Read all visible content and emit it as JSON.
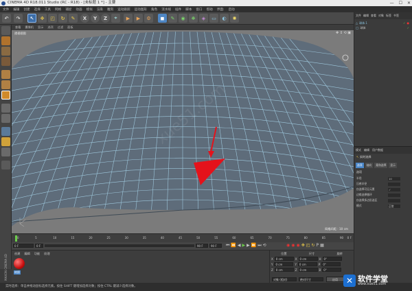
{
  "window": {
    "title": "CINEMA 4D R18.011 Studio (RC - R18) - [未标题 1 *] - 主要",
    "controls": [
      "—",
      "☐",
      "✕"
    ]
  },
  "menu": [
    "文件",
    "编辑",
    "创建",
    "选择",
    "工具",
    "网格",
    "捕捉",
    "动画",
    "模拟",
    "渲染",
    "雕刻",
    "运动跟踪",
    "运动图形",
    "角色",
    "流水线",
    "插件",
    "脚本",
    "窗口",
    "帮助",
    "界面:",
    "启动"
  ],
  "toolbar": {
    "axis_x": "X",
    "axis_y": "Y",
    "axis_z": "Z"
  },
  "viewport": {
    "menu": [
      "查看",
      "摄像机",
      "显示",
      "选项",
      "过滤",
      "面板"
    ],
    "label": "透视视图",
    "grid_readout": "网格间距 : 10 cm"
  },
  "timeline": {
    "ticks": [
      "0",
      "5",
      "10",
      "15",
      "20",
      "25",
      "30",
      "35",
      "40",
      "45",
      "50",
      "55",
      "60",
      "65",
      "70",
      "75",
      "80",
      "85",
      "90"
    ],
    "frame_end": "0 F"
  },
  "transport": {
    "start": "0 F",
    "current": "0 F",
    "end": "90 F",
    "end2": "90 F"
  },
  "material": {
    "menu": [
      "创建",
      "编辑",
      "功能",
      "纹理"
    ],
    "item_label": "材质"
  },
  "coords": {
    "headers": [
      "位置",
      "尺寸",
      "旋转"
    ],
    "rows": [
      {
        "axis": "X",
        "pos": "0 cm",
        "size": "0 cm",
        "rot_label": "H",
        "rot": "0°"
      },
      {
        "axis": "Y",
        "pos": "0 cm",
        "size": "0 cm",
        "rot_label": "P",
        "rot": "0°"
      },
      {
        "axis": "Z",
        "pos": "0 cm",
        "size": "0 cm",
        "rot_label": "B",
        "rot": "0°"
      }
    ],
    "mode": "对象 (相对)",
    "size_mode": "绝对尺寸",
    "apply": "应用"
  },
  "objects": {
    "tabs": [
      "文件",
      "编辑",
      "查看",
      "对象",
      "标签",
      "书签"
    ],
    "items": [
      "球体.1",
      "球体"
    ]
  },
  "attributes": {
    "tabs": [
      "模式",
      "编辑",
      "用户数据"
    ],
    "title": "实时选择",
    "subtabs": [
      "选项",
      "轴向",
      "柔和选择",
      "显示"
    ],
    "section": "选项",
    "rows": [
      {
        "label": "半径",
        "value": "10"
      },
      {
        "label": "压感半径",
        "value": ""
      },
      {
        "label": "仅选择可见元素",
        "value": "✓"
      },
      {
        "label": "边缘选择循环",
        "value": ""
      },
      {
        "label": "仅选择多边形选区",
        "value": ""
      },
      {
        "label": "模式",
        "value": "正常"
      }
    ]
  },
  "status": "实时选择：单击并拖动鼠标选择元素。按住 SHIFT 键增加选择对象；按住 CTRL 键减少选择对象。",
  "watermark": {
    "brand": "软件学堂",
    "url": "www.xue51.com",
    "overlay": "xue51.com"
  },
  "side_label": "MAXON CINEMA 4D",
  "colors": {
    "accent_blue": "#4a8fd8",
    "red_polygon": "#e4121b",
    "wire": "#9ec8dd",
    "mesh": "#5e6c7a"
  }
}
